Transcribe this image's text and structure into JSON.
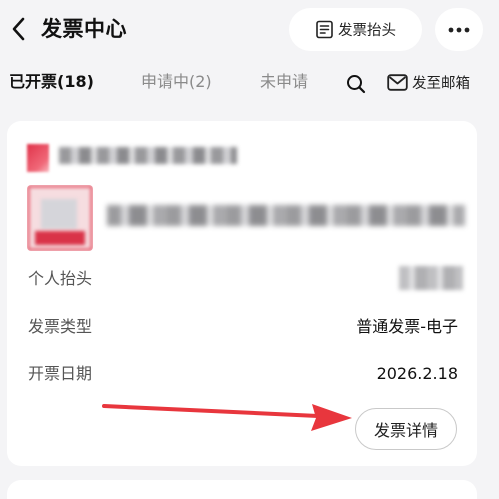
{
  "header": {
    "title": "发票中心",
    "invoice_title_button": "发票抬头",
    "icons": {
      "back": "chevron-left-icon",
      "invoice_title": "document-list-icon",
      "more": "more-dots-icon"
    }
  },
  "tabs": {
    "items": [
      {
        "label": "已开票(18)",
        "active": true
      },
      {
        "label": "申请中(2)",
        "active": false
      },
      {
        "label": "未申请",
        "active": false
      }
    ],
    "search_icon": "search-icon",
    "mail_icon": "mail-icon",
    "mail_label": "发至邮箱"
  },
  "invoice_card": {
    "fields": [
      {
        "label": "个人抬头",
        "value": ""
      },
      {
        "label": "发票类型",
        "value": "普通发票-电子"
      },
      {
        "label": "开票日期",
        "value": "2026.2.18"
      }
    ],
    "detail_button": "发票详情",
    "annotation_arrow_color": "#e8363d"
  },
  "colors": {
    "background": "#f4f4f6",
    "card": "#ffffff",
    "active_tab": "#111111",
    "inactive_tab": "#8a8a8a",
    "annotation_arrow": "#e8363d"
  }
}
